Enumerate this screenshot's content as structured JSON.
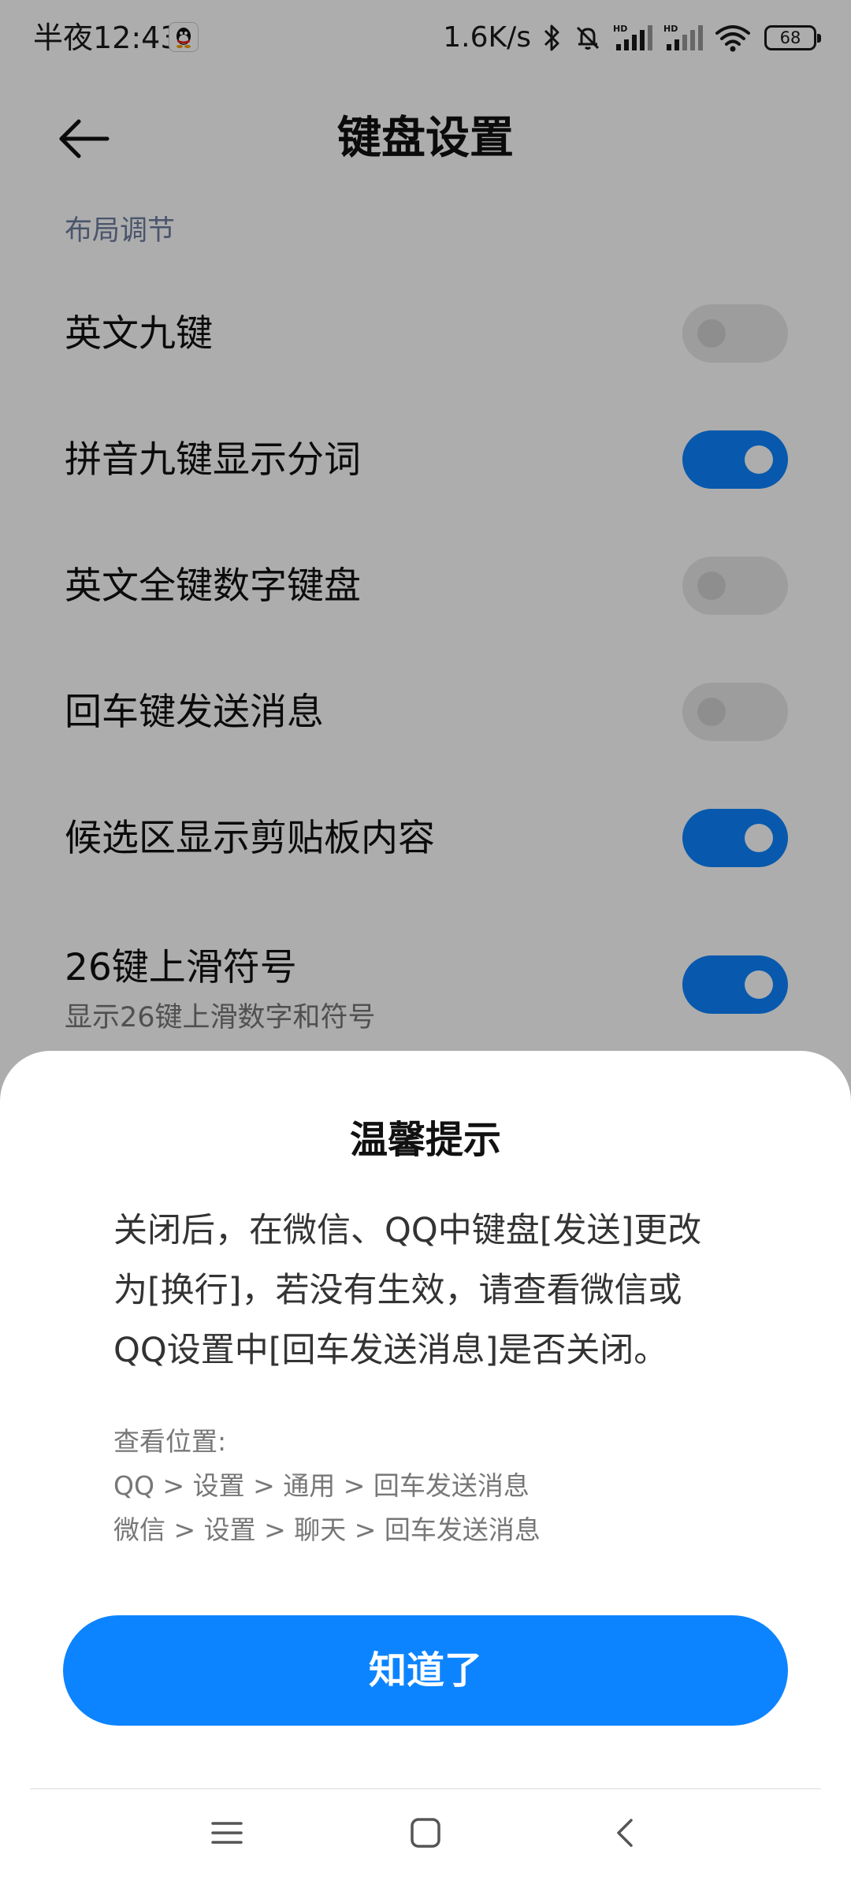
{
  "status_bar": {
    "time": "半夜12:43",
    "net_speed": "1.6K/s",
    "battery": "68",
    "icons": [
      "qq-icon",
      "bluetooth-icon",
      "mute-bell-icon",
      "hd-signal-icon",
      "hd-signal-icon",
      "wifi-icon",
      "battery-icon"
    ]
  },
  "header": {
    "title": "键盘设置",
    "back_icon": "arrow-left-icon"
  },
  "section": {
    "label": "布局调节"
  },
  "settings": [
    {
      "title": "英文九键",
      "enabled": false
    },
    {
      "title": "拼音九键显示分词",
      "enabled": true
    },
    {
      "title": "英文全键数字键盘",
      "enabled": false
    },
    {
      "title": "回车键发送消息",
      "enabled": false
    },
    {
      "title": "候选区显示剪贴板内容",
      "enabled": true
    },
    {
      "title": "26键上滑符号",
      "subtitle": "显示26键上滑数字和符号",
      "enabled": true
    }
  ],
  "dialog": {
    "title": "温馨提示",
    "message_lines": [
      "关闭后，在微信、QQ中键盘[发送]更改",
      "为[换行]，若没有生效，请查看微信或",
      "QQ设置中[回车发送消息]是否关闭。"
    ],
    "path_lines": [
      "查看位置:",
      "QQ > 设置 > 通用 > 回车发送消息",
      "微信 > 设置 > 聊天 > 回车发送消息"
    ],
    "confirm_label": "知道了"
  },
  "nav_bar": {
    "icons": [
      "menu-icon",
      "home-square-icon",
      "back-chevron-icon"
    ]
  },
  "colors": {
    "accent": "#0d84ff",
    "section_label": "#6e7ea0",
    "toggle_off": "#e8e8e8"
  }
}
